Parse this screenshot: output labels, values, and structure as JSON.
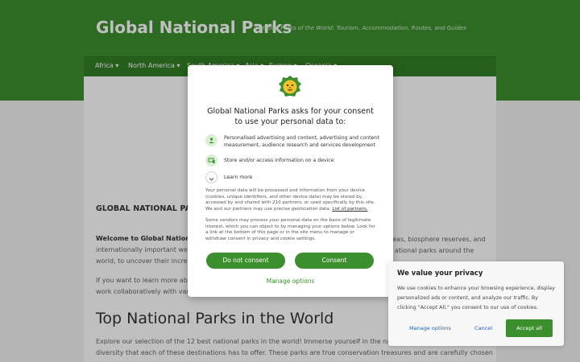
{
  "site": {
    "title": "Global National Parks",
    "tagline": "National Parks of the World: Tourism, Accommodation, Routes, and Guides"
  },
  "nav": {
    "items": [
      "Africa ▾",
      "North America ▾",
      "South America ▾",
      "Asia ▾",
      "Europe ▾",
      "Oceania ▾"
    ]
  },
  "content": {
    "section_heading": "GLOBAL NATIONAL PARKS",
    "intro_bold": "Welcome to Global National P",
    "intro_right_1": "reas, biosphere reserves, and",
    "intro_line2_left": "internationally important wetl",
    "intro_right_2": "ational parks around the",
    "intro_line3": "world, to uncover their incredi",
    "para2_line1": "If you want to learn more abou",
    "para2_line2": "work collaboratively with vario",
    "top_heading": "Top National Parks in the World",
    "explore_line1": "Explore our selection of the 12 best national parks in the world! Immerse yourself in the natural b",
    "explore_line2": "diversity that each of these destinations has to offer. These parks are true conservation treasures and are carefully chosen"
  },
  "consent": {
    "title": "Global National Parks asks for your consent to use your personal data to:",
    "purposes": [
      "Personalised advertising and content, advertising and content measurement, audience research and services development",
      "Store and/or access information on a device"
    ],
    "learn_more": "Learn more",
    "para1": "Your personal data will be processed and information from your device (cookies, unique identifiers, and other device data) may be stored by, accessed by and shared with 210 partners, or used specifically by this site. We and our partners may use precise geolocation data.",
    "partners_link": "List of partners.",
    "para2": "Some vendors may process your personal data on the basis of legitimate interest, which you can object to by managing your options below. Look for a link at the bottom of this page or in the site menu to manage or withdraw consent in privacy and cookie settings.",
    "do_not_consent": "Do not consent",
    "consent": "Consent",
    "manage_options": "Manage options"
  },
  "privacy": {
    "title": "We value your privacy",
    "text": "We use cookies to enhance your browsing experience, display personalized ads or content, and analyze our traffic. By clicking \"Accept All,\" you consent to our use of cookies.",
    "manage": "Manage options",
    "cancel": "Cancel",
    "accept_all": "Accept all"
  },
  "colors": {
    "brand_green": "#3b8f2d",
    "nav_green": "#337f26",
    "link_blue": "#2d62a0"
  }
}
